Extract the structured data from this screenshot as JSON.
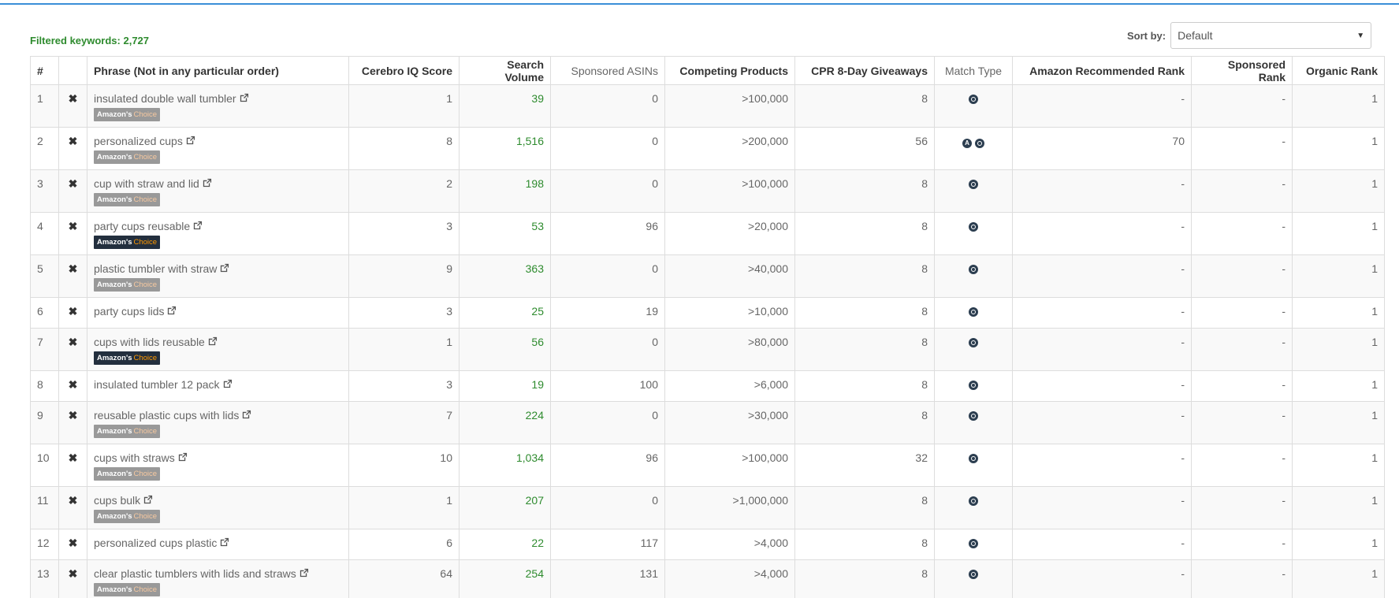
{
  "filtered_label": "Filtered keywords: 2,727",
  "sort": {
    "label": "Sort by:",
    "value": "Default"
  },
  "columns": [
    "#",
    "",
    "Phrase (Not in any particular order)",
    "Cerebro IQ Score",
    "Search Volume",
    "Sponsored ASINs",
    "Competing Products",
    "CPR 8-Day Giveaways",
    "Match Type",
    "Amazon Recommended Rank",
    "Sponsored Rank",
    "Organic Rank"
  ],
  "badge": {
    "amazons": "Amazon's",
    "choice": "Choice"
  },
  "rows": [
    {
      "n": "1",
      "phrase": "insulated double wall tumbler",
      "badge": "gray",
      "iq": "1",
      "vol": "39",
      "asins": "0",
      "comp": ">100,000",
      "cpr": "8",
      "match": [
        "b"
      ],
      "arr": "-",
      "sr": "-",
      "or": "1"
    },
    {
      "n": "2",
      "phrase": "personalized cups",
      "badge": "gray",
      "iq": "8",
      "vol": "1,516",
      "asins": "0",
      "comp": ">200,000",
      "cpr": "56",
      "match": [
        "a",
        "b"
      ],
      "arr": "70",
      "sr": "-",
      "or": "1"
    },
    {
      "n": "3",
      "phrase": "cup with straw and lid",
      "badge": "gray",
      "iq": "2",
      "vol": "198",
      "asins": "0",
      "comp": ">100,000",
      "cpr": "8",
      "match": [
        "b"
      ],
      "arr": "-",
      "sr": "-",
      "or": "1"
    },
    {
      "n": "4",
      "phrase": "party cups reusable",
      "badge": "dark",
      "iq": "3",
      "vol": "53",
      "asins": "96",
      "comp": ">20,000",
      "cpr": "8",
      "match": [
        "b"
      ],
      "arr": "-",
      "sr": "-",
      "or": "1"
    },
    {
      "n": "5",
      "phrase": "plastic tumbler with straw",
      "badge": "gray",
      "iq": "9",
      "vol": "363",
      "asins": "0",
      "comp": ">40,000",
      "cpr": "8",
      "match": [
        "b"
      ],
      "arr": "-",
      "sr": "-",
      "or": "1"
    },
    {
      "n": "6",
      "phrase": "party cups lids",
      "badge": "",
      "iq": "3",
      "vol": "25",
      "asins": "19",
      "comp": ">10,000",
      "cpr": "8",
      "match": [
        "b"
      ],
      "arr": "-",
      "sr": "-",
      "or": "1"
    },
    {
      "n": "7",
      "phrase": "cups with lids reusable",
      "badge": "dark",
      "iq": "1",
      "vol": "56",
      "asins": "0",
      "comp": ">80,000",
      "cpr": "8",
      "match": [
        "b"
      ],
      "arr": "-",
      "sr": "-",
      "or": "1"
    },
    {
      "n": "8",
      "phrase": "insulated tumbler 12 pack",
      "badge": "",
      "iq": "3",
      "vol": "19",
      "asins": "100",
      "comp": ">6,000",
      "cpr": "8",
      "match": [
        "b"
      ],
      "arr": "-",
      "sr": "-",
      "or": "1"
    },
    {
      "n": "9",
      "phrase": "reusable plastic cups with lids",
      "badge": "gray",
      "iq": "7",
      "vol": "224",
      "asins": "0",
      "comp": ">30,000",
      "cpr": "8",
      "match": [
        "b"
      ],
      "arr": "-",
      "sr": "-",
      "or": "1"
    },
    {
      "n": "10",
      "phrase": "cups with straws",
      "badge": "gray",
      "iq": "10",
      "vol": "1,034",
      "asins": "96",
      "comp": ">100,000",
      "cpr": "32",
      "match": [
        "b"
      ],
      "arr": "-",
      "sr": "-",
      "or": "1"
    },
    {
      "n": "11",
      "phrase": "cups bulk",
      "badge": "gray",
      "iq": "1",
      "vol": "207",
      "asins": "0",
      "comp": ">1,000,000",
      "cpr": "8",
      "match": [
        "b"
      ],
      "arr": "-",
      "sr": "-",
      "or": "1"
    },
    {
      "n": "12",
      "phrase": "personalized cups plastic",
      "badge": "",
      "iq": "6",
      "vol": "22",
      "asins": "117",
      "comp": ">4,000",
      "cpr": "8",
      "match": [
        "b"
      ],
      "arr": "-",
      "sr": "-",
      "or": "1"
    },
    {
      "n": "13",
      "phrase": "clear plastic tumblers with lids and straws",
      "badge": "gray",
      "iq": "64",
      "vol": "254",
      "asins": "131",
      "comp": ">4,000",
      "cpr": "8",
      "match": [
        "b"
      ],
      "arr": "-",
      "sr": "-",
      "or": "1"
    }
  ]
}
